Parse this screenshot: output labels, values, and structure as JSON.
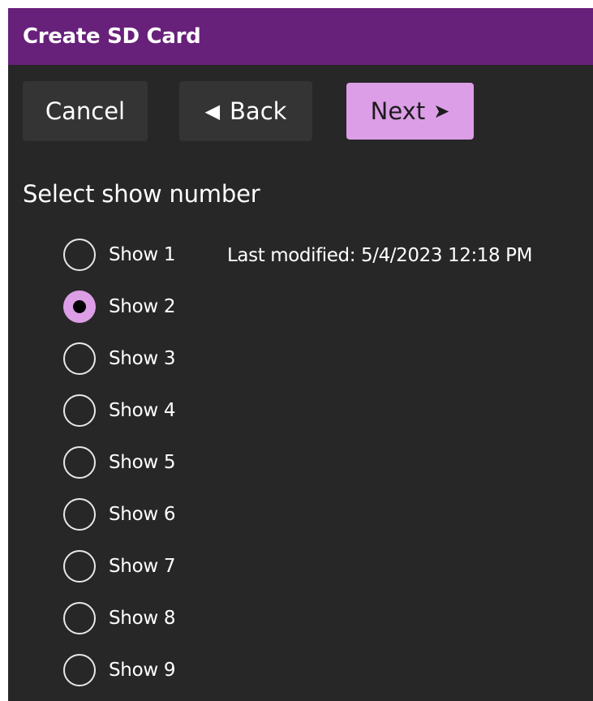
{
  "window": {
    "title": "Create SD Card"
  },
  "toolbar": {
    "cancel_label": "Cancel",
    "back_label": "Back",
    "next_label": "Next",
    "back_icon": "chevron-left-icon",
    "next_icon": "chevron-right-icon"
  },
  "show_select": {
    "heading": "Select show number",
    "selected": "Show 2",
    "options": [
      {
        "label": "Show 1",
        "checked": false
      },
      {
        "label": "Show 2",
        "checked": true
      },
      {
        "label": "Show 3",
        "checked": false
      },
      {
        "label": "Show 4",
        "checked": false
      },
      {
        "label": "Show 5",
        "checked": false
      },
      {
        "label": "Show 6",
        "checked": false
      },
      {
        "label": "Show 7",
        "checked": false
      },
      {
        "label": "Show 8",
        "checked": false
      },
      {
        "label": "Show 9",
        "checked": false
      }
    ],
    "last_modified": "Last modified: 5/4/2023 12:18 PM"
  },
  "colors": {
    "titlebar": "#68217a",
    "background": "#272727",
    "button": "#343434",
    "accent": "#dc9ee6"
  }
}
